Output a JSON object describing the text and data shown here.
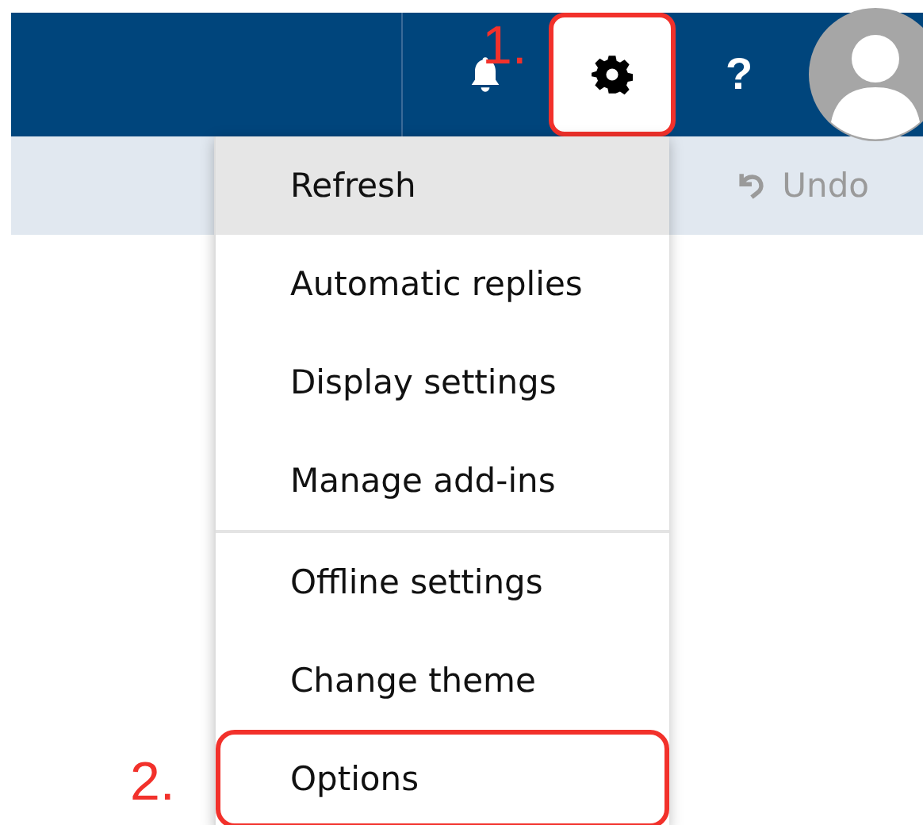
{
  "header": {
    "buttons": [
      {
        "kind": "bell",
        "selected": false,
        "highlighted": false
      },
      {
        "kind": "gear",
        "selected": true,
        "highlighted": true
      },
      {
        "kind": "help",
        "label": "?",
        "selected": false,
        "highlighted": false
      }
    ]
  },
  "toolbar": {
    "undo": {
      "label": "Undo",
      "disabled": true
    }
  },
  "menu": {
    "items": [
      {
        "label": "Refresh",
        "selected": true,
        "highlighted": false,
        "divider_before": false
      },
      {
        "label": "Automatic replies",
        "selected": false,
        "highlighted": false,
        "divider_before": false
      },
      {
        "label": "Display settings",
        "selected": false,
        "highlighted": false,
        "divider_before": false
      },
      {
        "label": "Manage add-ins",
        "selected": false,
        "highlighted": false,
        "divider_before": false
      },
      {
        "label": "Offline settings",
        "selected": false,
        "highlighted": false,
        "divider_before": true
      },
      {
        "label": "Change theme",
        "selected": false,
        "highlighted": false,
        "divider_before": false
      },
      {
        "label": "Options",
        "selected": false,
        "highlighted": true,
        "divider_before": false
      }
    ]
  },
  "annotations": [
    {
      "label": "1."
    },
    {
      "label": "2."
    }
  ]
}
